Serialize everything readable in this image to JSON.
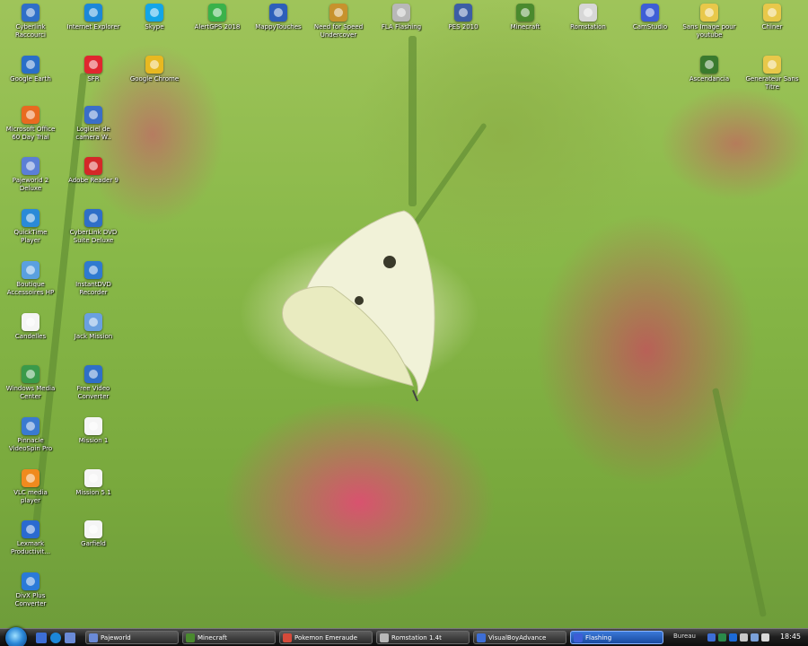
{
  "desktop": {
    "icons": [
      {
        "id": "i1",
        "name": "cyberlink-icon",
        "label": "Cyberlink Raccourci",
        "color": "#2f6fc8"
      },
      {
        "id": "i2",
        "name": "internet-explorer-icon",
        "label": "Internet Explorer",
        "color": "#1c87d8"
      },
      {
        "id": "i3",
        "name": "skype-icon",
        "label": "Skype",
        "color": "#12a5e8"
      },
      {
        "id": "i4",
        "name": "gps-icon",
        "label": "AlertGPS 2018",
        "color": "#3ab24a"
      },
      {
        "id": "i5",
        "name": "mappy-icon",
        "label": "MappyTouches",
        "color": "#2d5fba"
      },
      {
        "id": "i6",
        "name": "nfs-icon",
        "label": "Need for Speed Undercover",
        "color": "#c7922d"
      },
      {
        "id": "i7",
        "name": "flashing-icon",
        "label": "FLA Flashing",
        "color": "#b8b8b8"
      },
      {
        "id": "i8",
        "name": "pes-icon",
        "label": "PES 2010",
        "color": "#3c5ea5"
      },
      {
        "id": "i9",
        "name": "minecraft-icon",
        "label": "Minecraft",
        "color": "#4a8a2e"
      },
      {
        "id": "i10",
        "name": "rom-icon",
        "label": "Romstation",
        "color": "#d7d7d7"
      },
      {
        "id": "i11",
        "name": "camstudio-icon",
        "label": "CamStudio",
        "color": "#3d5ed6"
      },
      {
        "id": "i12",
        "name": "folder-icon",
        "label": "Sans Image pour youtube",
        "color": "#e8c84a"
      },
      {
        "id": "i13",
        "name": "folder-icon",
        "label": "Chiner",
        "color": "#e8c84a"
      },
      {
        "id": "i14",
        "name": "google-earth-icon",
        "label": "Google Earth",
        "color": "#2a6fc8"
      },
      {
        "id": "i15",
        "name": "sfr-icon",
        "label": "SFR",
        "color": "#e0262f"
      },
      {
        "id": "i16",
        "name": "chrome-icon",
        "label": "Google Chrome",
        "color": "#e8b820"
      },
      {
        "id": "i17",
        "name": "minecraft-icon",
        "label": "Ascendancia",
        "color": "#3a7a2e"
      },
      {
        "id": "i18",
        "name": "folder-icon",
        "label": "Generateur Sans Titre",
        "color": "#e8c84a"
      },
      {
        "id": "i19",
        "name": "office-icon",
        "label": "Microsoft Office 60 Day Trial",
        "color": "#e86a20"
      },
      {
        "id": "i20",
        "name": "camera-icon",
        "label": "Logiciel de camera W..",
        "color": "#3a6ec8"
      },
      {
        "id": "i21",
        "name": "word-icon",
        "label": "Pajeworld 2 Deluxe",
        "color": "#5b7fd6"
      },
      {
        "id": "i22",
        "name": "adobe-reader-icon",
        "label": "Adobe Reader 9",
        "color": "#d42828"
      },
      {
        "id": "i23",
        "name": "quicktime-icon",
        "label": "QuickTime Player",
        "color": "#2a8ad8"
      },
      {
        "id": "i24",
        "name": "cyberlink-icon",
        "label": "CyberLink DVD Suite Deluxe",
        "color": "#2f6fc8"
      },
      {
        "id": "i25",
        "name": "nero-icon",
        "label": "Boutique Accessoires HP",
        "color": "#5aa0e0"
      },
      {
        "id": "i26",
        "name": "dvd-icon",
        "label": "InstantDVD Recorder",
        "color": "#2f7ad0"
      },
      {
        "id": "i27",
        "name": "document-icon",
        "label": "Candelles",
        "color": "#f5f5f5"
      },
      {
        "id": "i28",
        "name": "mission-icon",
        "label": "Jack Mission",
        "color": "#6aa0e0"
      },
      {
        "id": "i29",
        "name": "media-center-icon",
        "label": "Windows Media Center",
        "color": "#3a9a4a"
      },
      {
        "id": "i30",
        "name": "video-converter-icon",
        "label": "Free Video Converter",
        "color": "#2f6fc8"
      },
      {
        "id": "i31",
        "name": "pinnacle-icon",
        "label": "Pinnacle VideoSpin Pro",
        "color": "#3a7ad0"
      },
      {
        "id": "i32",
        "name": "document-icon",
        "label": "Mission 1",
        "color": "#f5f5f5"
      },
      {
        "id": "i33",
        "name": "vlc-icon",
        "label": "VLC media player",
        "color": "#f08a1e"
      },
      {
        "id": "i34",
        "name": "document-icon",
        "label": "Mission 5.1",
        "color": "#f5f5f5"
      },
      {
        "id": "i35",
        "name": "lexmark-icon",
        "label": "Lexmark Productivit...",
        "color": "#2a6ad0"
      },
      {
        "id": "i36",
        "name": "document-icon",
        "label": "Garfield",
        "color": "#f5f5f5"
      },
      {
        "id": "i37",
        "name": "divx-icon",
        "label": "DivX Plus Converter",
        "color": "#2a7ad8"
      }
    ]
  },
  "taskbar": {
    "tasks": [
      {
        "name": "task-pajeworld",
        "label": "Pajeworld",
        "color": "#6a8ad6",
        "active": false
      },
      {
        "name": "task-minecraft",
        "label": "Minecraft",
        "color": "#4a8a2e",
        "active": false
      },
      {
        "name": "task-pokemon",
        "label": "Pokemon Emeraude",
        "color": "#d44a3a",
        "active": false
      },
      {
        "name": "task-romstation",
        "label": "Romstation 1.4t",
        "color": "#b8b8b8",
        "active": false
      },
      {
        "name": "task-visualboyadvance",
        "label": "VisualBoyAdvance",
        "color": "#3d6ed6",
        "active": false
      },
      {
        "name": "task-flashing",
        "label": "Flashing",
        "color": "#3d5ed6",
        "active": true
      }
    ],
    "tray_label": "Bureau",
    "clock": "18:45"
  }
}
